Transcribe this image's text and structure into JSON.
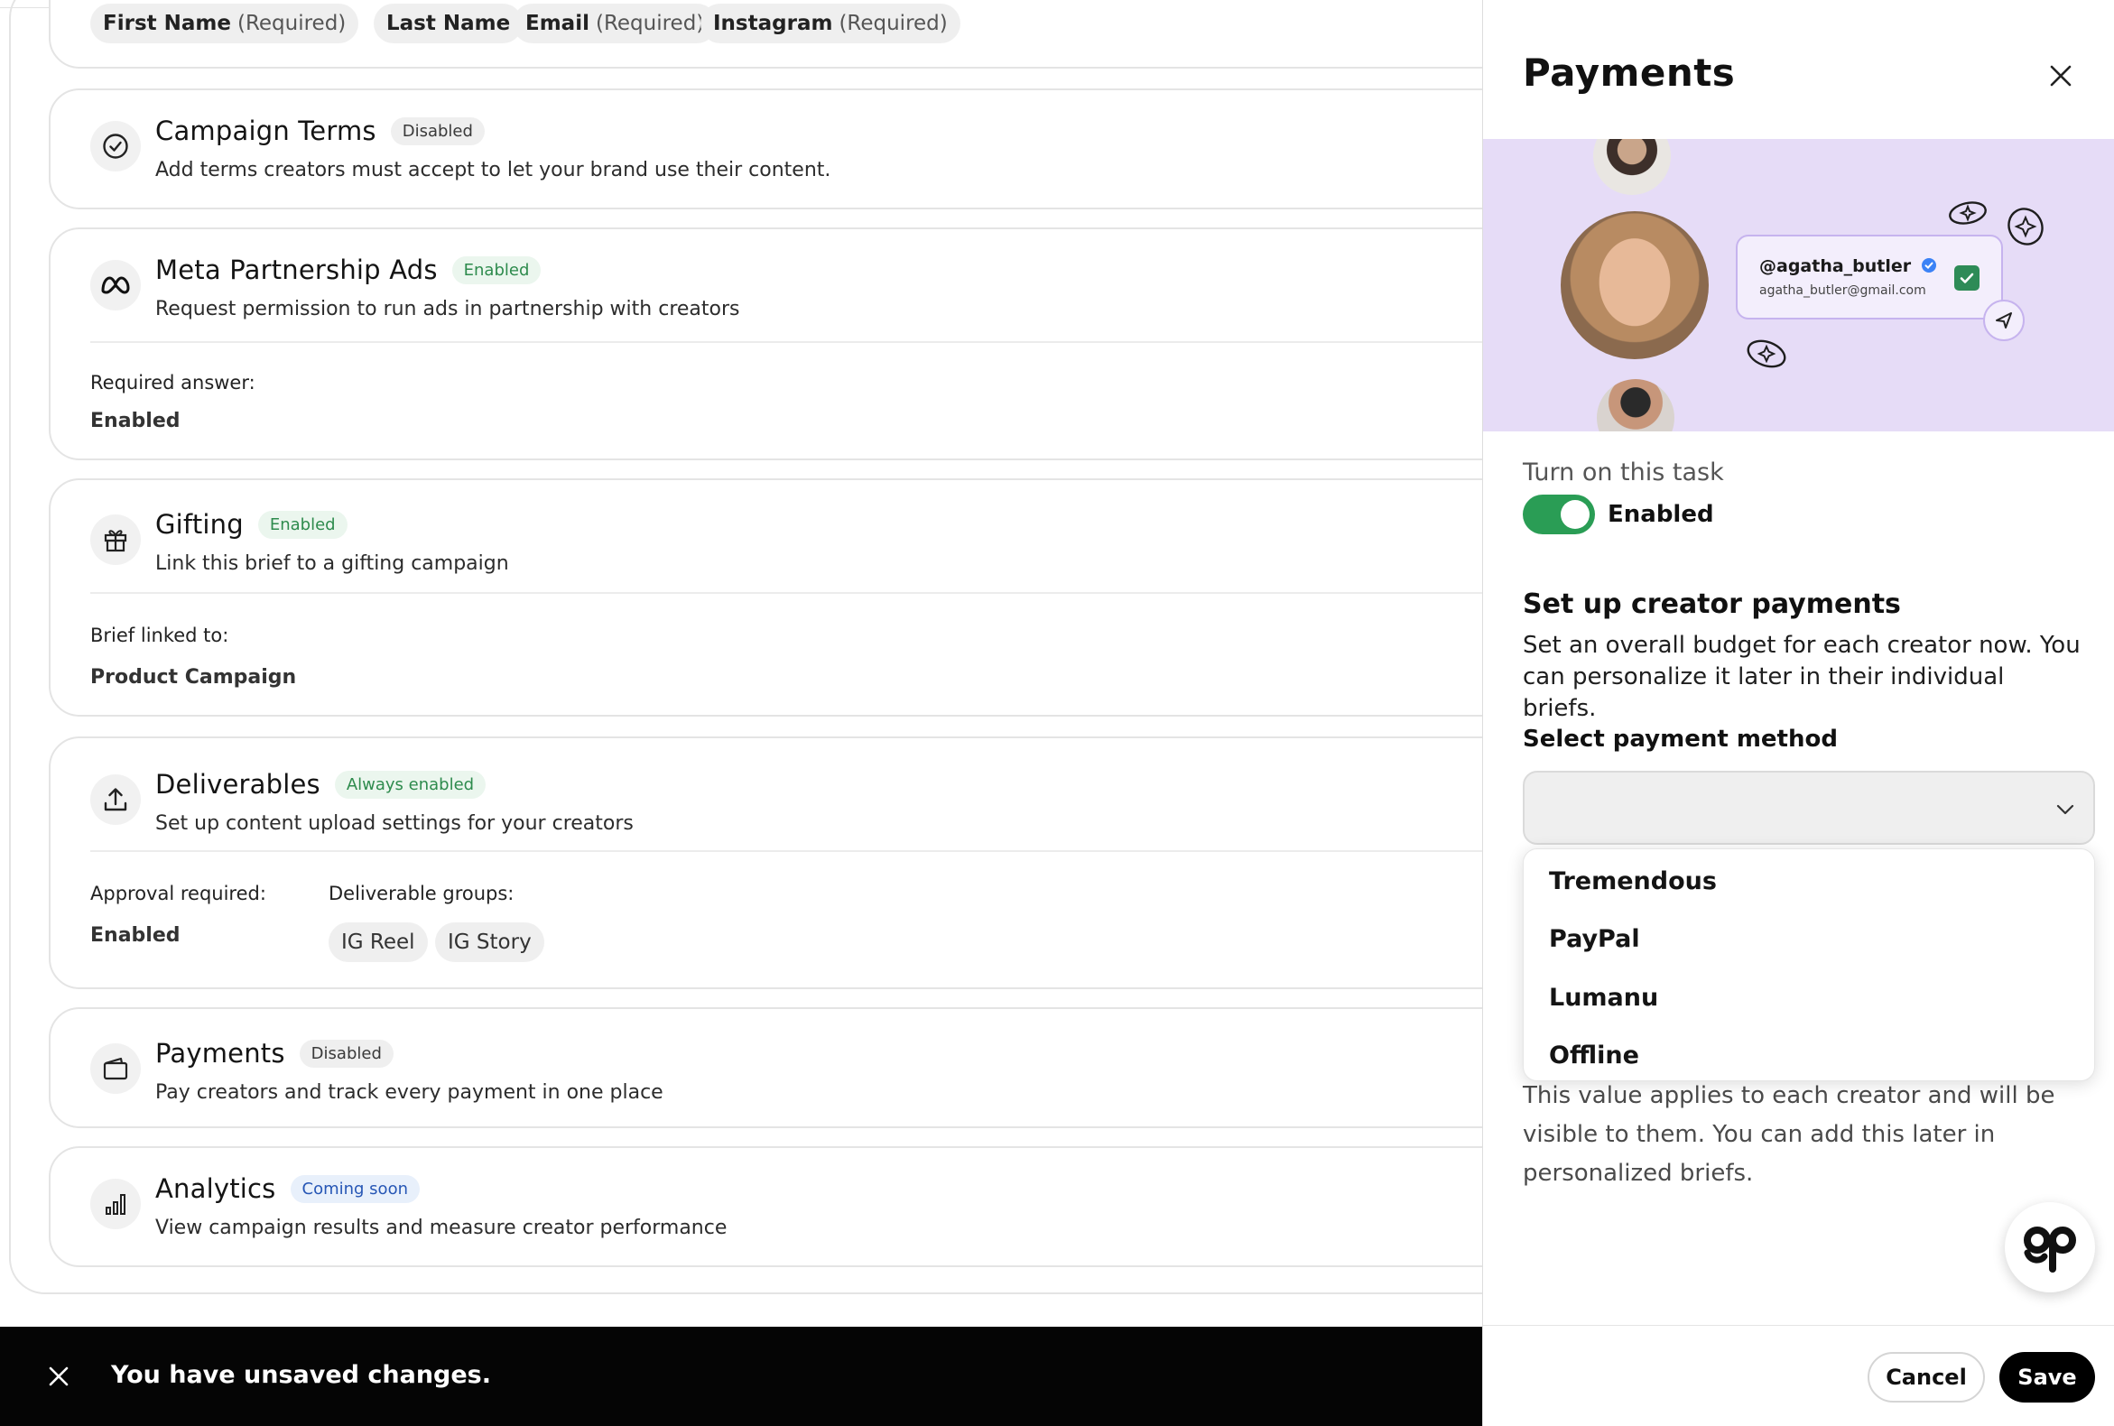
{
  "contact_fields": [
    {
      "name": "First Name",
      "suffix": "(Required)"
    },
    {
      "name": "Last Name",
      "suffix": ""
    },
    {
      "name": "Email",
      "suffix": "(Required)"
    },
    {
      "name": "Instagram",
      "suffix": "(Required)"
    }
  ],
  "cards": {
    "campaign_terms": {
      "title": "Campaign Terms",
      "badge": "Disabled",
      "desc": "Add terms creators must accept to let your brand use their content.",
      "icon": "check-circle-icon"
    },
    "meta_ads": {
      "title": "Meta Partnership Ads",
      "badge": "Enabled",
      "desc": "Request permission to run ads in partnership with creators",
      "icon": "meta-logo-icon",
      "field_label": "Required answer:",
      "field_value": "Enabled"
    },
    "gifting": {
      "title": "Gifting",
      "badge": "Enabled",
      "desc": "Link this brief to a gifting campaign",
      "icon": "gift-icon",
      "field_label": "Brief linked to:",
      "field_value": "Product Campaign"
    },
    "deliverables": {
      "title": "Deliverables",
      "badge": "Always enabled",
      "desc": "Set up content upload settings for your creators",
      "icon": "upload-icon",
      "approval_label": "Approval required:",
      "approval_value": "Enabled",
      "groups_label": "Deliverable groups:",
      "groups": [
        "IG Reel",
        "IG Story"
      ]
    },
    "payments": {
      "title": "Payments",
      "badge": "Disabled",
      "desc": "Pay creators and track every payment in one place",
      "icon": "wallet-icon"
    },
    "analytics": {
      "title": "Analytics",
      "badge": "Coming soon",
      "desc": "View campaign results and measure creator performance",
      "icon": "bar-chart-icon"
    }
  },
  "unsaved_bar": {
    "message": "You have unsaved changes."
  },
  "drawer": {
    "title": "Payments",
    "hero": {
      "handle": "@agatha_butler",
      "email": "agatha_butler@gmail.com"
    },
    "toggle": {
      "label": "Turn on this task",
      "state": "Enabled",
      "on": true
    },
    "setup": {
      "heading": "Set up creator payments",
      "desc": "Set an overall budget for each creator now. You can personalize it later in their individual briefs."
    },
    "payment_method": {
      "label": "Select payment method",
      "selected": "",
      "options": [
        "Tremendous",
        "PayPal",
        "Lumanu",
        "Offline"
      ]
    },
    "hint": "This value applies to each creator and will be visible to them. You can add this later in personalized briefs.",
    "footer": {
      "cancel": "Cancel",
      "save": "Save"
    }
  },
  "colors": {
    "enabled_green": "#2a9d55",
    "hero_bg": "#e6dcf7",
    "accent_purple": "#c6b3ee",
    "black": "#000000"
  }
}
